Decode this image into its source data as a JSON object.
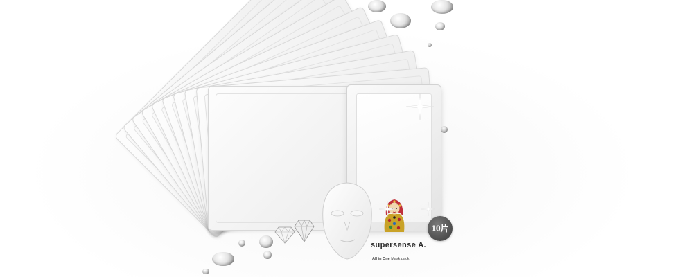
{
  "product": {
    "brand_name": "supersense A.",
    "line_strong": "All in One",
    "line_rest": " Mask pack",
    "count_badge": "10片"
  },
  "colors": {
    "badge": "#5a5a5a",
    "pack_white": "#f2f2f2",
    "text_dark": "#2b2b2b"
  },
  "icons": [
    "doll-logo-icon",
    "sparkle-icon",
    "water-bubble-icon",
    "diamond-icon",
    "sheet-mask-icon"
  ]
}
